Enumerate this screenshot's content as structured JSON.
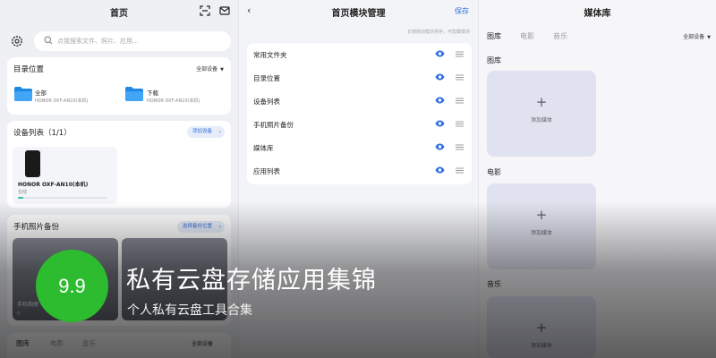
{
  "home": {
    "title": "首页",
    "search_placeholder": "点我搜索文件、照片、应用...",
    "dir_card": {
      "title": "目录位置",
      "filter": "全部设备",
      "folders": [
        {
          "name": "全部",
          "device": "HONOR OXF-AN10(本机)"
        },
        {
          "name": "下载",
          "device": "HONOR OXF-AN10(本机)"
        }
      ]
    },
    "device_card": {
      "title": "设备列表（1/1）",
      "add_label": "添加设备",
      "device": {
        "name": "HONOR OXF-AN10(本机)",
        "status": "在线",
        "usage_fraction": 0.06
      }
    },
    "backup_card": {
      "title": "手机照片备份",
      "select_label": "选择备份位置",
      "thumbs": [
        {
          "label": "手机相册",
          "count": "0"
        },
        {
          "label": "",
          "count": ""
        }
      ]
    },
    "bottom_tabs": [
      "图库",
      "电影",
      "音乐"
    ],
    "bottom_filter": "全部设备"
  },
  "module": {
    "title": "首页模块管理",
    "save_label": "保存",
    "hint": "长按拖动模块排序，可隐藏模块",
    "items": [
      "常用文件夹",
      "目录位置",
      "设备列表",
      "手机照片备份",
      "媒体库",
      "应用列表"
    ]
  },
  "media": {
    "title": "媒体库",
    "tabs": [
      "图库",
      "电影",
      "音乐"
    ],
    "filter": "全部设备",
    "sections": [
      {
        "title": "图库",
        "add_label": "添加媒体"
      },
      {
        "title": "电影",
        "add_label": "添加媒体"
      },
      {
        "title": "音乐",
        "add_label": "添加媒体"
      }
    ]
  },
  "overlay": {
    "score": "9.9",
    "title": "私有云盘存储应用集锦",
    "subtitle": "个人私有云盘工具合集"
  },
  "colors": {
    "accent": "#2f6fde",
    "score_badge": "#2dbb2f",
    "folder": "#1e88e5",
    "eye": "#2f6fde"
  }
}
